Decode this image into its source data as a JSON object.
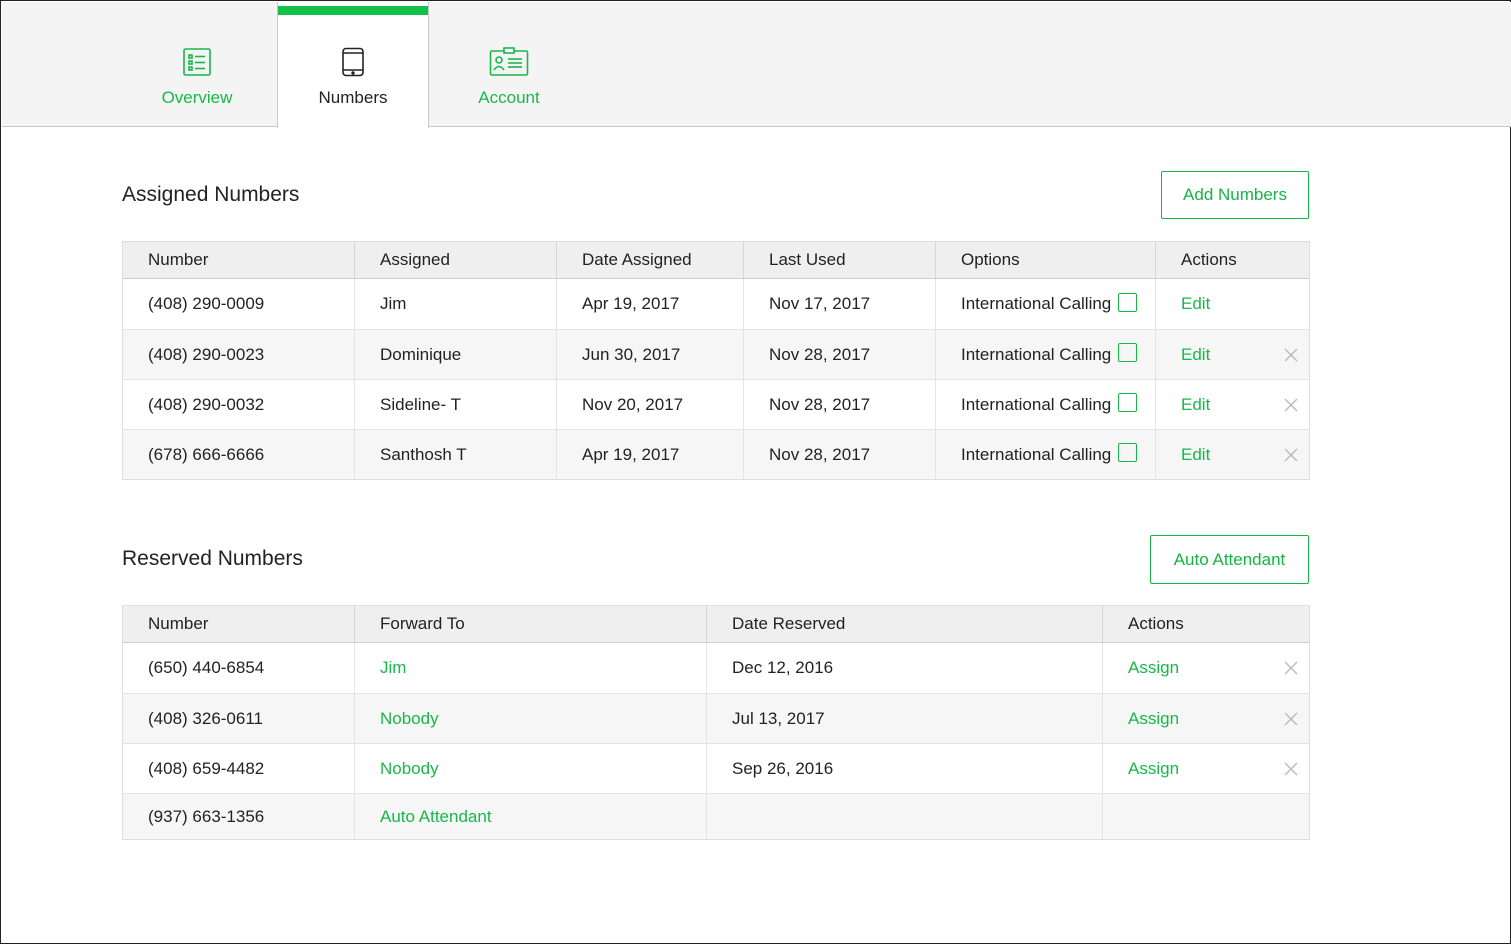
{
  "tabs": [
    {
      "label": "Overview",
      "icon": "list-icon"
    },
    {
      "label": "Numbers",
      "icon": "phone-icon"
    },
    {
      "label": "Account",
      "icon": "id-card-icon"
    }
  ],
  "assigned": {
    "title": "Assigned Numbers",
    "add_button": "Add Numbers",
    "headers": [
      "Number",
      "Assigned",
      "Date Assigned",
      "Last Used",
      "Options",
      "Actions"
    ],
    "rows": [
      {
        "number": "(408) 290-0009",
        "assigned": "Jim",
        "date_assigned": "Apr 19, 2017",
        "last_used": "Nov 17, 2017",
        "option": "International Calling",
        "checked": false,
        "action": "Edit",
        "removable": false
      },
      {
        "number": "(408) 290-0023",
        "assigned": "Dominique",
        "date_assigned": "Jun 30, 2017",
        "last_used": "Nov 28, 2017",
        "option": "International Calling",
        "checked": false,
        "action": "Edit",
        "removable": true
      },
      {
        "number": "(408) 290-0032",
        "assigned": "Sideline- T",
        "date_assigned": "Nov 20, 2017",
        "last_used": "Nov 28, 2017",
        "option": "International Calling",
        "checked": false,
        "action": "Edit",
        "removable": true
      },
      {
        "number": "(678) 666-6666",
        "assigned": "Santhosh T",
        "date_assigned": "Apr 19, 2017",
        "last_used": "Nov 28, 2017",
        "option": "International Calling",
        "checked": false,
        "action": "Edit",
        "removable": true
      }
    ]
  },
  "reserved": {
    "title": "Reserved Numbers",
    "auto_button": "Auto Attendant",
    "headers": [
      "Number",
      "Forward To",
      "Date Reserved",
      "Actions"
    ],
    "rows": [
      {
        "number": "(650) 440-6854",
        "forward_to": "Jim",
        "date_reserved": "Dec 12, 2016",
        "action": "Assign",
        "removable": true
      },
      {
        "number": "(408) 326-0611",
        "forward_to": "Nobody",
        "date_reserved": "Jul 13, 2017",
        "action": "Assign",
        "removable": true
      },
      {
        "number": "(408) 659-4482",
        "forward_to": "Nobody",
        "date_reserved": "Sep 26, 2016",
        "action": "Assign",
        "removable": true
      },
      {
        "number": "(937) 663-1356",
        "forward_to": "Auto Attendant",
        "date_reserved": "",
        "action": "",
        "removable": false
      }
    ]
  },
  "colors": {
    "accent": "#15c04a",
    "link": "#17b84a",
    "header_bg": "#efefef"
  }
}
